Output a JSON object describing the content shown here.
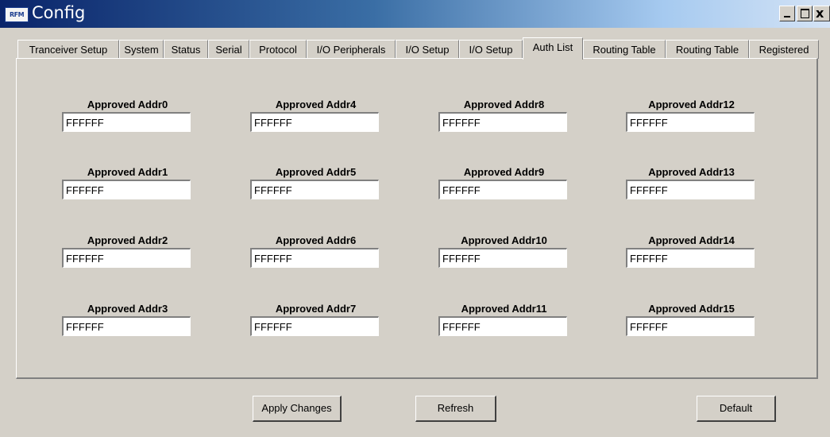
{
  "window": {
    "title": "Config",
    "icon_text": "RFM",
    "close_glyph": "x"
  },
  "tabs": [
    {
      "label": "Tranceiver Setup",
      "active": false
    },
    {
      "label": "System",
      "active": false
    },
    {
      "label": "Status",
      "active": false
    },
    {
      "label": "Serial",
      "active": false
    },
    {
      "label": "Protocol",
      "active": false
    },
    {
      "label": "I/O Peripherals",
      "active": false
    },
    {
      "label": "I/O Setup",
      "active": false
    },
    {
      "label": "I/O Setup",
      "active": false
    },
    {
      "label": "Auth List",
      "active": true
    },
    {
      "label": "Routing Table",
      "active": false
    },
    {
      "label": "Routing Table",
      "active": false
    },
    {
      "label": "Registered",
      "active": false
    }
  ],
  "fields": [
    {
      "label": "Approved Addr0",
      "value": "FFFFFF"
    },
    {
      "label": "Approved Addr1",
      "value": "FFFFFF"
    },
    {
      "label": "Approved Addr2",
      "value": "FFFFFF"
    },
    {
      "label": "Approved Addr3",
      "value": "FFFFFF"
    },
    {
      "label": "Approved Addr4",
      "value": "FFFFFF"
    },
    {
      "label": "Approved Addr5",
      "value": "FFFFFF"
    },
    {
      "label": "Approved Addr6",
      "value": "FFFFFF"
    },
    {
      "label": "Approved Addr7",
      "value": "FFFFFF"
    },
    {
      "label": "Approved Addr8",
      "value": "FFFFFF"
    },
    {
      "label": "Approved Addr9",
      "value": "FFFFFF"
    },
    {
      "label": "Approved Addr10",
      "value": "FFFFFF"
    },
    {
      "label": "Approved Addr11",
      "value": "FFFFFF"
    },
    {
      "label": "Approved Addr12",
      "value": "FFFFFF"
    },
    {
      "label": "Approved Addr13",
      "value": "FFFFFF"
    },
    {
      "label": "Approved Addr14",
      "value": "FFFFFF"
    },
    {
      "label": "Approved Addr15",
      "value": "FFFFFF"
    }
  ],
  "buttons": {
    "apply": "Apply Changes",
    "refresh": "Refresh",
    "default": "Default"
  },
  "colors": {
    "titlebar_start": "#0a246a",
    "titlebar_end": "#d4e3f5",
    "face": "#d4d0c8"
  }
}
